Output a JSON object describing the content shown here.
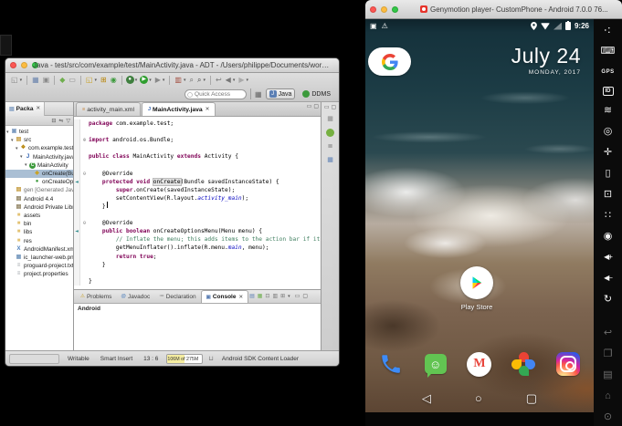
{
  "eclipse": {
    "window_title": "Java - test/src/com/example/test/MainActivity.java - ADT - /Users/philippe/Documents/workspace",
    "toolbar": {
      "quick_access_placeholder": "Quick Access",
      "perspective_java": "Java",
      "perspective_ddms": "DDMS",
      "icons": [
        {
          "name": "new-wizard",
          "glyph": "◱",
          "color": "#8a8a8a",
          "menu": true
        },
        {
          "sep": true
        },
        {
          "name": "save",
          "glyph": "▦",
          "color": "#6b84ad"
        },
        {
          "name": "print",
          "glyph": "▣",
          "color": "#8a8a8a"
        },
        {
          "sep": true
        },
        {
          "name": "android-sdk-manager",
          "glyph": "◆",
          "color": "#6fae4e"
        },
        {
          "name": "avd-manager",
          "glyph": "▭",
          "color": "#888888"
        },
        {
          "sep": true
        },
        {
          "name": "new-java-project",
          "glyph": "◱",
          "color": "#c9a227",
          "menu": true
        },
        {
          "name": "new-package",
          "glyph": "⊞",
          "color": "#b8860b"
        },
        {
          "name": "new-class",
          "glyph": "◉",
          "color": "#3c9a3c"
        },
        {
          "sep": true
        },
        {
          "name": "debug",
          "glyph": "●",
          "color": "#3f7f3f",
          "circle": true,
          "menu": true
        },
        {
          "name": "run",
          "glyph": "▶",
          "color": "#2f9e2f",
          "circle": true,
          "menu": true
        },
        {
          "name": "external-tools",
          "glyph": "▶",
          "color": "#8a8a8a",
          "menu": true
        },
        {
          "sep": true
        },
        {
          "name": "coverage",
          "glyph": "▥",
          "color": "#a24d3f",
          "menu": true
        },
        {
          "name": "java-search",
          "glyph": "⌕",
          "color": "#666666"
        },
        {
          "name": "search",
          "glyph": "⌕",
          "color": "#444444",
          "menu": true
        },
        {
          "sep": true
        },
        {
          "name": "last-edit-location",
          "glyph": "↩",
          "color": "#777777"
        },
        {
          "name": "back-history",
          "glyph": "◀",
          "color": "#777777",
          "menu": true
        },
        {
          "name": "forward-history",
          "glyph": "▶",
          "color": "#aaaaaa",
          "menu": true
        }
      ]
    },
    "package_explorer": {
      "tab_label": "Packa",
      "toolbar_icons": [
        {
          "name": "collapse-all",
          "glyph": "⊟"
        },
        {
          "name": "link-with-editor",
          "glyph": "⇋"
        },
        {
          "name": "view-menu",
          "glyph": "▽"
        }
      ],
      "items": [
        {
          "label": "test",
          "indent": 0,
          "icon": "project",
          "exp": true
        },
        {
          "label": "src",
          "indent": 1,
          "icon": "src",
          "exp": true
        },
        {
          "label": "com.example.test",
          "indent": 2,
          "icon": "package",
          "exp": true
        },
        {
          "label": "MainActivity.java",
          "indent": 3,
          "icon": "javafile",
          "exp": true
        },
        {
          "label": "MainActivity",
          "indent": 4,
          "icon": "class",
          "exp": true
        },
        {
          "label": "onCreate(Bu",
          "indent": 5,
          "icon": "method_protected",
          "selected": true
        },
        {
          "label": "onCreateOp",
          "indent": 5,
          "icon": "method_public"
        },
        {
          "label": "gen [Generated Java File",
          "indent": 1,
          "icon": "src",
          "dim": true
        },
        {
          "label": "Android 4.4",
          "indent": 1,
          "icon": "library"
        },
        {
          "label": "Android Private Libraries",
          "indent": 1,
          "icon": "library"
        },
        {
          "label": "assets",
          "indent": 1,
          "icon": "folder"
        },
        {
          "label": "bin",
          "indent": 1,
          "icon": "folder"
        },
        {
          "label": "libs",
          "indent": 1,
          "icon": "folder"
        },
        {
          "label": "res",
          "indent": 1,
          "icon": "folder"
        },
        {
          "label": "AndroidManifest.xml",
          "indent": 1,
          "icon": "xml"
        },
        {
          "label": "ic_launcher-web.png",
          "indent": 1,
          "icon": "img"
        },
        {
          "label": "proguard-project.txt",
          "indent": 1,
          "icon": "txt"
        },
        {
          "label": "project.properties",
          "indent": 1,
          "icon": "txt"
        }
      ]
    },
    "editor": {
      "tabs": [
        {
          "label": "activity_main.xml",
          "icon": "xml",
          "active": false
        },
        {
          "label": "MainActivity.java",
          "icon": "java",
          "active": true
        }
      ],
      "syntax_colors": {
        "kw": "#7f0055",
        "cm": "#3f7f5f",
        "st": "#0000c0",
        "pl": "#000000",
        "occ": "#e2e2e2"
      },
      "code": [
        {
          "segs": [
            {
              "t": "package ",
              "c": "kw"
            },
            {
              "t": "com.example.test;",
              "c": "pl"
            }
          ]
        },
        {
          "segs": []
        },
        {
          "fold": "⊕",
          "segs": [
            {
              "t": "import ",
              "c": "kw"
            },
            {
              "t": "android.os.Bundle;",
              "c": "pl"
            }
          ]
        },
        {
          "segs": []
        },
        {
          "segs": [
            {
              "t": "public class ",
              "c": "kw"
            },
            {
              "t": "MainActivity ",
              "c": "pl"
            },
            {
              "t": "extends ",
              "c": "kw"
            },
            {
              "t": "Activity {",
              "c": "pl"
            }
          ]
        },
        {
          "segs": []
        },
        {
          "fold": "⊖",
          "segs": [
            {
              "t": "    @Override",
              "c": "pl"
            }
          ]
        },
        {
          "arrow": true,
          "segs": [
            {
              "t": "    ",
              "c": "pl"
            },
            {
              "t": "protected void ",
              "c": "kw"
            },
            {
              "t": "onCreate",
              "c": "occ"
            },
            {
              "t": "(Bundle savedInstanceState) {",
              "c": "pl"
            }
          ]
        },
        {
          "segs": [
            {
              "t": "        ",
              "c": "pl"
            },
            {
              "t": "super",
              "c": "kw"
            },
            {
              "t": ".onCreate(savedInstanceState);",
              "c": "pl"
            }
          ]
        },
        {
          "segs": [
            {
              "t": "        setContentView(R.layout.",
              "c": "pl"
            },
            {
              "t": "activity_main",
              "c": "st"
            },
            {
              "t": ");",
              "c": "pl"
            }
          ]
        },
        {
          "cursor": true,
          "segs": [
            {
              "t": "    }",
              "c": "pl"
            }
          ]
        },
        {
          "segs": []
        },
        {
          "fold": "⊖",
          "segs": [
            {
              "t": "    @Override",
              "c": "pl"
            }
          ]
        },
        {
          "arrow": true,
          "segs": [
            {
              "t": "    ",
              "c": "pl"
            },
            {
              "t": "public boolean ",
              "c": "kw"
            },
            {
              "t": "onCreateOptionsMenu(Menu menu) {",
              "c": "pl"
            }
          ]
        },
        {
          "segs": [
            {
              "t": "        ",
              "c": "pl"
            },
            {
              "t": "// Inflate the menu; this adds items to the action bar if it is prese",
              "c": "cm"
            }
          ]
        },
        {
          "segs": [
            {
              "t": "        getMenuInflater().inflate(R.menu.",
              "c": "pl"
            },
            {
              "t": "main",
              "c": "st"
            },
            {
              "t": ", menu);",
              "c": "pl"
            }
          ]
        },
        {
          "segs": [
            {
              "t": "        ",
              "c": "pl"
            },
            {
              "t": "return true",
              "c": "kw"
            },
            {
              "t": ";",
              "c": "pl"
            }
          ]
        },
        {
          "segs": [
            {
              "t": "    }",
              "c": "pl"
            }
          ]
        },
        {
          "segs": []
        },
        {
          "segs": [
            {
              "t": "}",
              "c": "pl"
            }
          ]
        }
      ]
    },
    "right_strip_icons": [
      {
        "name": "task-list",
        "glyph": "▦",
        "color": "#888888"
      },
      {
        "name": "mylyn-connect",
        "glyph": "●",
        "color": "#76b041",
        "circle": true
      },
      {
        "name": "outline",
        "glyph": "≣",
        "color": "#777777"
      },
      {
        "name": "templates",
        "glyph": "▦",
        "color": "#5b7fb4"
      }
    ],
    "console": {
      "tabs": [
        {
          "label": "Problems",
          "icon": "⚠",
          "color": "#c9a227"
        },
        {
          "label": "Javadoc",
          "icon": "@",
          "color": "#4a7dbb"
        },
        {
          "label": "Declaration",
          "icon": "≔",
          "color": "#888888"
        },
        {
          "label": "Console",
          "icon": "▣",
          "color": "#5b7fb4",
          "active": true
        }
      ],
      "toolbar_icons": [
        {
          "name": "clear-console",
          "glyph": "▤",
          "color": "#5b7fb4"
        },
        {
          "name": "display-selected-console",
          "glyph": "▦",
          "color": "#6fae4e"
        },
        {
          "name": "scroll-lock",
          "glyph": "⊡",
          "color": "#777777"
        },
        {
          "name": "pin-console",
          "glyph": "▥",
          "color": "#777777"
        },
        {
          "name": "open-console",
          "glyph": "⊞",
          "color": "#777777",
          "menu": true
        },
        {
          "name": "minimize-panel",
          "glyph": "▭",
          "color": "#555555"
        },
        {
          "name": "maximize-panel",
          "glyph": "▢",
          "color": "#555555"
        }
      ],
      "content_label": "Android"
    },
    "status_bar": {
      "writable": "Writable",
      "insert_mode": "Smart Insert",
      "caret_position": "13 : 6",
      "heap": "106M of 275M",
      "heap_fill_pct": 50,
      "loader": "Android SDK Content Loader"
    }
  },
  "genymotion": {
    "window_title": "Genymotion player- CustomPhone - Android 7.0.0 76...",
    "android": {
      "time": "9:26",
      "date_day": "July 24",
      "date_sub": "MONDAY, 2017",
      "play_store_label": "Play Store",
      "status_left_icons": [
        {
          "name": "screenshot-notification",
          "glyph": "▣"
        },
        {
          "name": "warning-notification",
          "glyph": "⚠"
        }
      ],
      "dock": [
        {
          "name": "phone"
        },
        {
          "name": "messaging",
          "glyph": "☺"
        },
        {
          "name": "gmail",
          "glyph": "M"
        },
        {
          "name": "photos"
        },
        {
          "name": "instagram"
        }
      ],
      "nav": [
        {
          "name": "back",
          "glyph": "◁"
        },
        {
          "name": "home",
          "glyph": "○"
        },
        {
          "name": "recents",
          "glyph": "▢"
        }
      ]
    },
    "sidebar_icons": [
      {
        "name": "share",
        "glyph": "∴",
        "rot": true
      },
      {
        "name": "keyboard",
        "glyph": "⌨"
      },
      {
        "name": "gps",
        "glyph": "GPS",
        "text": true
      },
      {
        "name": "identifiers",
        "glyph": "ID",
        "box": true
      },
      {
        "name": "network",
        "glyph": "≋"
      },
      {
        "name": "camera",
        "glyph": "◎"
      },
      {
        "name": "remote-control",
        "glyph": "✛"
      },
      {
        "name": "battery",
        "glyph": "▯"
      },
      {
        "name": "screencast",
        "glyph": "⊡"
      },
      {
        "name": "pixel-perfect",
        "glyph": "∷"
      },
      {
        "name": "capture",
        "glyph": "◉"
      },
      {
        "name": "volume-up",
        "glyph": "◀+",
        "small": true
      },
      {
        "name": "volume-down",
        "glyph": "◀−",
        "small": true
      },
      {
        "name": "rotate-screen",
        "glyph": "↻"
      },
      {
        "name": "android-back",
        "glyph": "↩",
        "dim": true,
        "gap": true
      },
      {
        "name": "android-recents",
        "glyph": "❐",
        "dim": true
      },
      {
        "name": "android-menu",
        "glyph": "▤",
        "dim": true
      },
      {
        "name": "android-home",
        "glyph": "⌂",
        "dim": true
      },
      {
        "name": "android-power",
        "glyph": "⊙",
        "dim": true
      }
    ]
  }
}
